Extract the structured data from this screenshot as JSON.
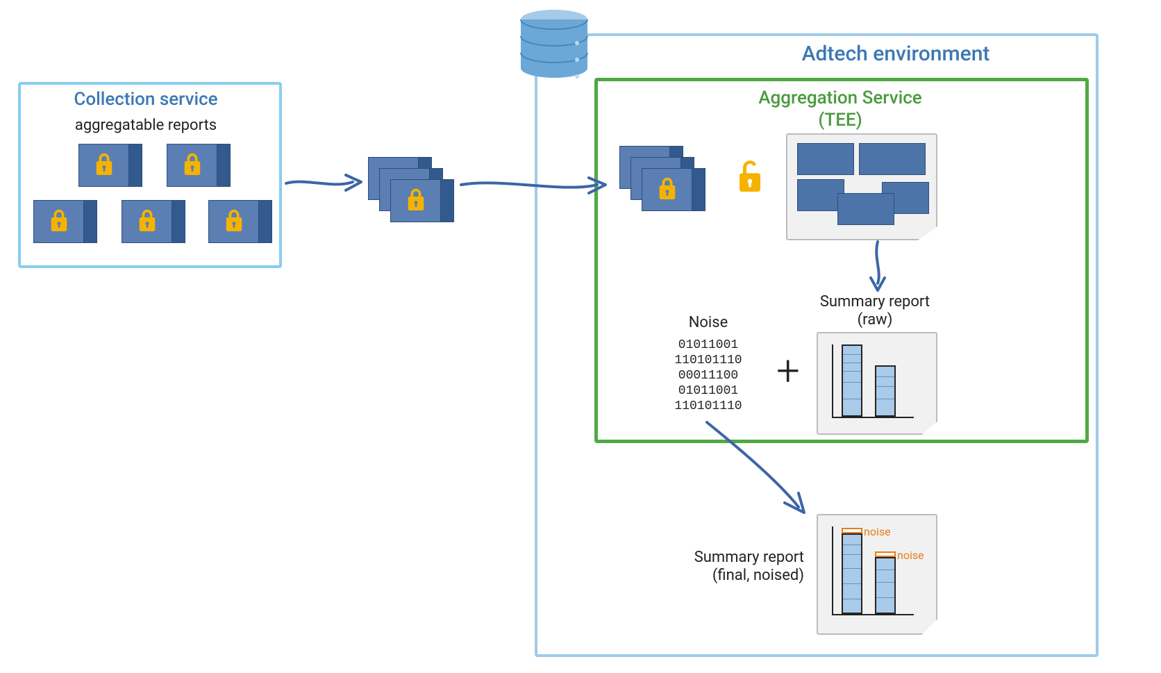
{
  "collection": {
    "title": "Collection service",
    "subtitle": "aggregatable reports"
  },
  "adtech": {
    "title": "Adtech environment"
  },
  "aggregation": {
    "title_line1": "Aggregation Service",
    "title_line2": "(TEE)"
  },
  "noise": {
    "label": "Noise",
    "bits": [
      "01011001",
      "110101110",
      "00011100",
      "01011001",
      "110101110"
    ]
  },
  "plus_symbol": "+",
  "summary_raw": {
    "line1": "Summary report",
    "line2": "(raw)"
  },
  "summary_final": {
    "line1": "Summary report",
    "line2": "(final, noised)"
  },
  "noise_annotation": "noise",
  "colors": {
    "border_light_blue": "#88cdef",
    "border_green": "#4fa943",
    "card_fill": "#5b7eb3",
    "card_tab": "#325a8d",
    "lock": "#f5b300",
    "title_blue": "#3b78b5",
    "title_green": "#4a9b3d",
    "orange": "#e97c1a"
  },
  "report_cards_collection_count": 5,
  "transit_stack_count": 3,
  "agg_stack_count": 3
}
